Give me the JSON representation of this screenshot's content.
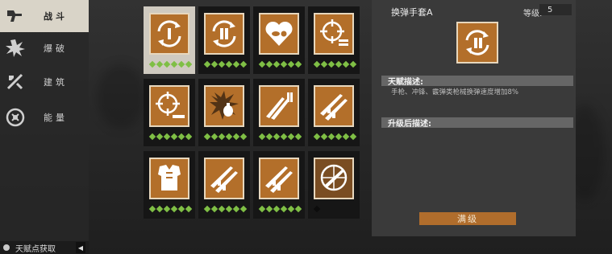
{
  "sidebar": {
    "items": [
      {
        "label": "战斗",
        "icon": "combat-icon"
      },
      {
        "label": "爆破",
        "icon": "explosion-icon"
      },
      {
        "label": "建筑",
        "icon": "build-icon"
      },
      {
        "label": "能量",
        "icon": "energy-icon"
      }
    ],
    "footer_label": "天赋点获取",
    "footer_arrow": "◀"
  },
  "talents": [
    {
      "icon": "reload-icon",
      "dots": 6,
      "black_dots": 0
    },
    {
      "icon": "reload-bullet-icon",
      "dots": 6,
      "black_dots": 0
    },
    {
      "icon": "heart-pill-icon",
      "dots": 6,
      "black_dots": 0
    },
    {
      "icon": "crosshair-ammo-icon",
      "dots": 6,
      "black_dots": 0
    },
    {
      "icon": "crosshair-bullet-icon",
      "dots": 6,
      "black_dots": 0
    },
    {
      "icon": "grenade-blast-icon",
      "dots": 6,
      "black_dots": 0
    },
    {
      "icon": "rifles-bullets-icon",
      "dots": 6,
      "black_dots": 0
    },
    {
      "icon": "rifles-icon",
      "dots": 6,
      "black_dots": 0
    },
    {
      "icon": "body-armor-icon",
      "dots": 6,
      "black_dots": 0
    },
    {
      "icon": "rifles-icon",
      "dots": 6,
      "black_dots": 0
    },
    {
      "icon": "rifles-icon",
      "dots": 6,
      "black_dots": 0
    },
    {
      "icon": "scope-rifle-icon",
      "dots": 0,
      "black_dots": 1
    }
  ],
  "panel": {
    "title": "换弹手套A",
    "level_label": "等级:",
    "level_value": "5",
    "talent_desc_header": "天赋描述:",
    "talent_desc": "手枪、冲锋、霰弹类枪械换弹速度增加8%",
    "upgrade_desc_header": "升级后描述:",
    "max_button": "满级"
  },
  "colors": {
    "tile": "#b36f2a",
    "dot": "#7fbf45",
    "selected_bg": "#cfcac0"
  }
}
